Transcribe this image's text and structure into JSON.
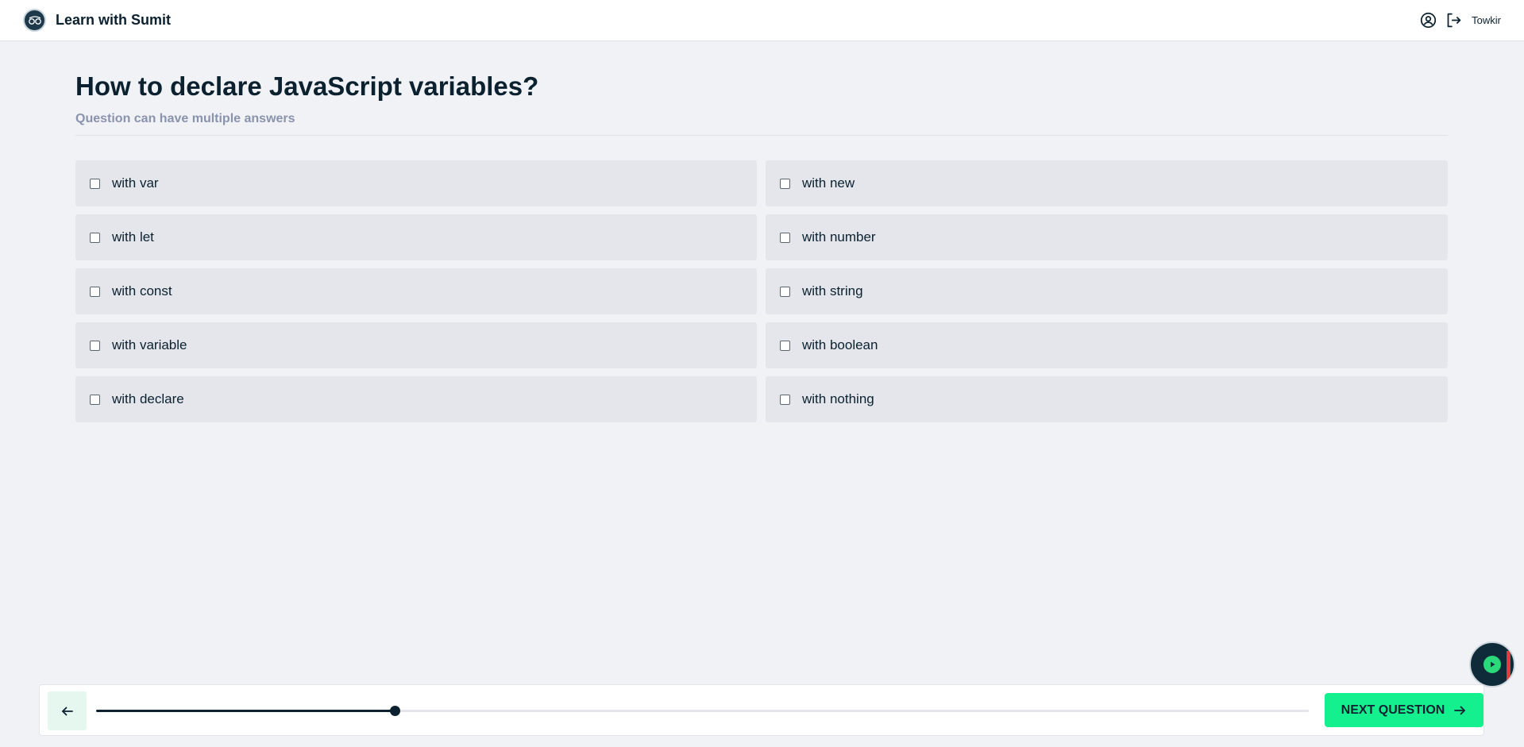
{
  "header": {
    "brand": "Learn with Sumit",
    "user_name": "Towkir",
    "icons": [
      "logo-icon",
      "user-circle-icon",
      "logout-icon"
    ]
  },
  "quiz": {
    "title": "How to declare JavaScript variables?",
    "subtitle": "Question can have multiple answers",
    "options": [
      {
        "label": "with var",
        "checked": false
      },
      {
        "label": "with new",
        "checked": false
      },
      {
        "label": "with let",
        "checked": false
      },
      {
        "label": "with number",
        "checked": false
      },
      {
        "label": "with const",
        "checked": false
      },
      {
        "label": "with string",
        "checked": false
      },
      {
        "label": "with variable",
        "checked": false
      },
      {
        "label": "with boolean",
        "checked": false
      },
      {
        "label": "with declare",
        "checked": false
      },
      {
        "label": "with nothing",
        "checked": false
      }
    ]
  },
  "footer": {
    "progress_fraction": 0.246,
    "next_label": "NEXT QUESTION"
  },
  "colors": {
    "accent": "#15f08f",
    "dark": "#0b2130",
    "background": "#f1f2f6",
    "option_bg": "#e4e6ec",
    "subtitle": "#8a93ad"
  }
}
